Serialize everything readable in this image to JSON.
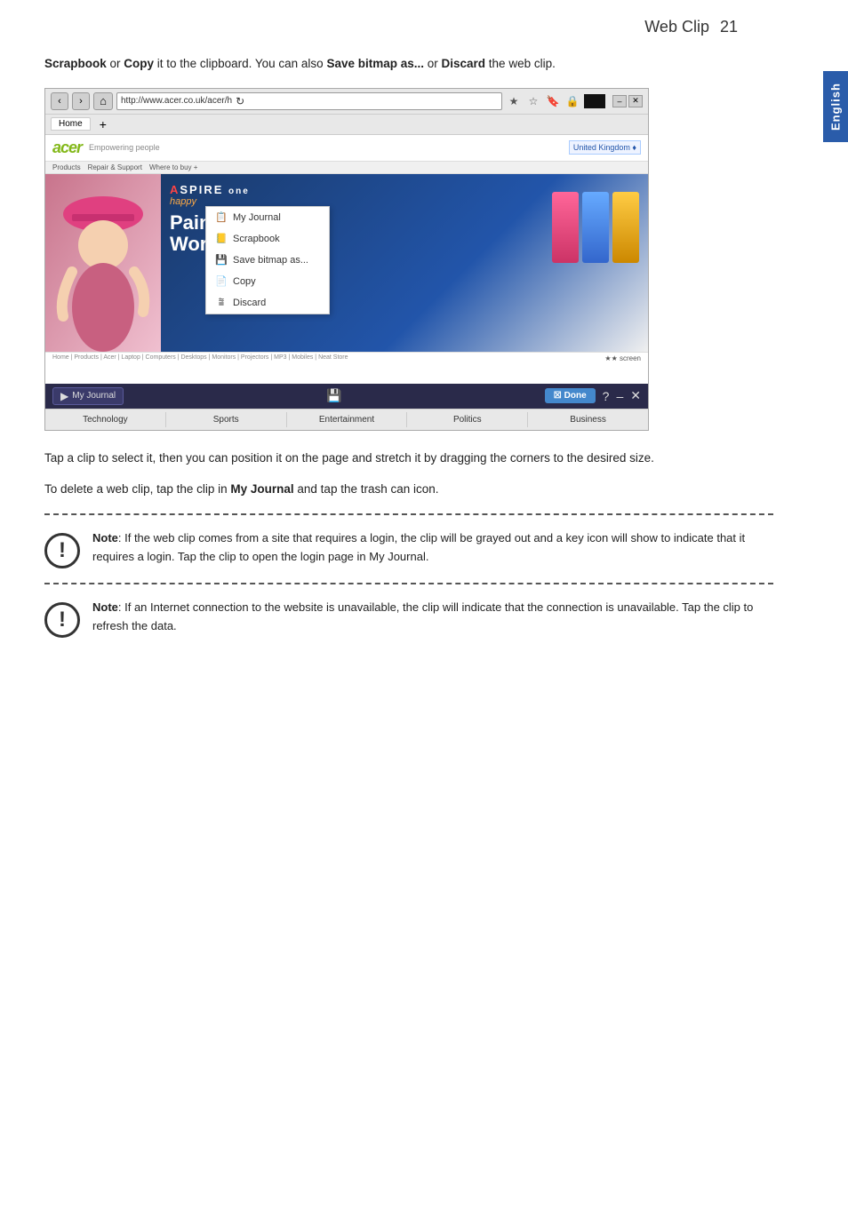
{
  "page": {
    "title": "Web Clip",
    "page_number": "21",
    "english_tab": "English"
  },
  "intro_text": {
    "part1": " or ",
    "scrapbook": "Scrapbook",
    "copy_word": "Copy",
    "part2": " it to the clipboard. You can also ",
    "save_bitmap": "Save bitmap as...",
    "part3": " or ",
    "discard": "Discard",
    "part4": " the web clip."
  },
  "browser": {
    "url": "http://www.acer.co.uk/acer/h",
    "tabs_row": [
      "Home",
      "+"
    ],
    "acer_logo": "acer",
    "acer_tagline": "Empowering people",
    "acer_region": "United Kingdom ♦",
    "nav_links": [
      "Products",
      "Repair & Support",
      "Where to buy +"
    ],
    "aspire_text": "ASPIRE one",
    "aspire_sub": "happy",
    "paint_text": "Paint your World",
    "context_menu_items": [
      {
        "icon": "📋",
        "label": "My Journal"
      },
      {
        "icon": "📒",
        "label": "Scrapbook"
      },
      {
        "icon": "💾",
        "label": "Save bitmap as..."
      },
      {
        "icon": "📄",
        "label": "Copy"
      },
      {
        "icon": "⊗",
        "label": "Discard"
      }
    ],
    "bottom_bar": {
      "my_journal": "My Journal",
      "done": "Done"
    },
    "bottom_tabs": [
      "Technology",
      "Sports",
      "Entertainment",
      "Politics",
      "Business"
    ]
  },
  "body_paragraphs": {
    "para1": "Tap a clip to select it, then you can position it on the page and stretch it by dragging the corners to the desired size.",
    "para2_pre": "To delete a web clip, tap the clip in ",
    "para2_bold": "My Journal",
    "para2_post": " and tap the trash can icon."
  },
  "notes": [
    {
      "icon": "!",
      "text_pre": "Note",
      "text_colon": ": If the web clip comes from a site that requires a login, the clip will be grayed out and a key icon will show to indicate that it requires a login. Tap the clip to open the login page in My Journal."
    },
    {
      "icon": "!",
      "text_pre": "Note",
      "text_colon": ": If an Internet connection to the website is unavailable, the clip will indicate that the connection is unavailable. Tap the clip to refresh the data."
    }
  ]
}
